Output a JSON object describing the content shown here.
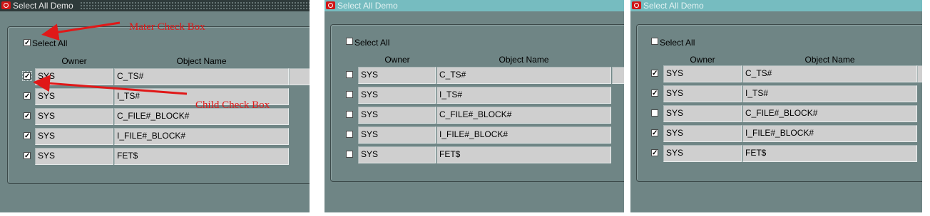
{
  "window_title": "Select All Demo",
  "select_all_label": "Select All",
  "columns": {
    "owner": "Owner",
    "object_name": "Object Name"
  },
  "annotations": {
    "master": "Mater Check Box",
    "child": "Child Check Box"
  },
  "accent_color": "#e01818",
  "panels": [
    {
      "state": "active",
      "select_all_checked": true,
      "rows": [
        {
          "checked": true,
          "owner": "SYS",
          "object": "C_TS#"
        },
        {
          "checked": true,
          "owner": "SYS",
          "object": "I_TS#"
        },
        {
          "checked": true,
          "owner": "SYS",
          "object": "C_FILE#_BLOCK#"
        },
        {
          "checked": true,
          "owner": "SYS",
          "object": "I_FILE#_BLOCK#"
        },
        {
          "checked": true,
          "owner": "SYS",
          "object": "FET$"
        }
      ]
    },
    {
      "state": "inactive",
      "select_all_checked": false,
      "rows": [
        {
          "checked": false,
          "owner": "SYS",
          "object": "C_TS#"
        },
        {
          "checked": false,
          "owner": "SYS",
          "object": "I_TS#"
        },
        {
          "checked": false,
          "owner": "SYS",
          "object": "C_FILE#_BLOCK#"
        },
        {
          "checked": false,
          "owner": "SYS",
          "object": "I_FILE#_BLOCK#"
        },
        {
          "checked": false,
          "owner": "SYS",
          "object": "FET$"
        }
      ]
    },
    {
      "state": "inactive",
      "select_all_checked": false,
      "rows": [
        {
          "checked": true,
          "owner": "SYS",
          "object": "C_TS#"
        },
        {
          "checked": true,
          "owner": "SYS",
          "object": "I_TS#"
        },
        {
          "checked": false,
          "owner": "SYS",
          "object": "C_FILE#_BLOCK#"
        },
        {
          "checked": true,
          "owner": "SYS",
          "object": "I_FILE#_BLOCK#"
        },
        {
          "checked": true,
          "owner": "SYS",
          "object": "FET$"
        }
      ]
    }
  ]
}
